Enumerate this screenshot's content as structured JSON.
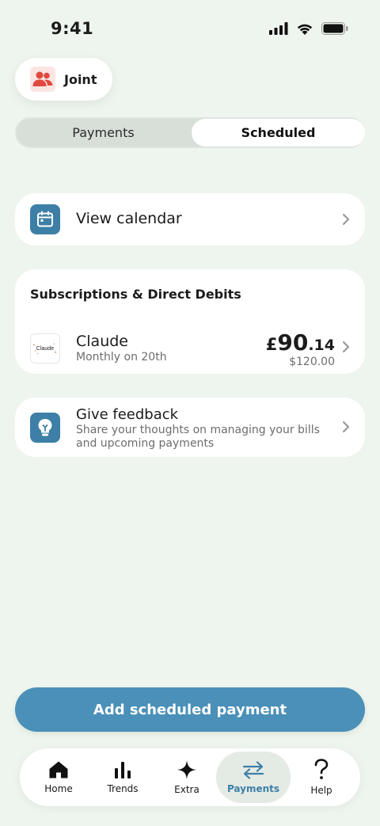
{
  "status": {
    "time": "9:41"
  },
  "account": {
    "label": "Joint"
  },
  "segments": {
    "payments": "Payments",
    "scheduled": "Scheduled"
  },
  "calendar": {
    "label": "View calendar"
  },
  "subscriptions": {
    "title": "Subscriptions & Direct Debits",
    "items": [
      {
        "name": "Claude",
        "logo_text": "Claude",
        "schedule": "Monthly on 20th",
        "amount_currency": "£",
        "amount_whole": "90",
        "amount_fraction": ".14",
        "original_amount": "$120.00"
      }
    ]
  },
  "feedback": {
    "title": "Give feedback",
    "description": "Share your thoughts on managing your bills and upcoming payments"
  },
  "add_button": {
    "label": "Add scheduled payment"
  },
  "tabs": [
    {
      "label": "Home",
      "icon": "home-icon"
    },
    {
      "label": "Trends",
      "icon": "trends-icon"
    },
    {
      "label": "Extra",
      "icon": "sparkle-icon"
    },
    {
      "label": "Payments",
      "icon": "transfer-arrows-icon",
      "active": true
    },
    {
      "label": "Help",
      "icon": "question-icon"
    }
  ],
  "colors": {
    "accent": "#3d7fa6",
    "button": "#4a90b8",
    "background": "#eef5ee",
    "account_icon": "#e0483e"
  }
}
